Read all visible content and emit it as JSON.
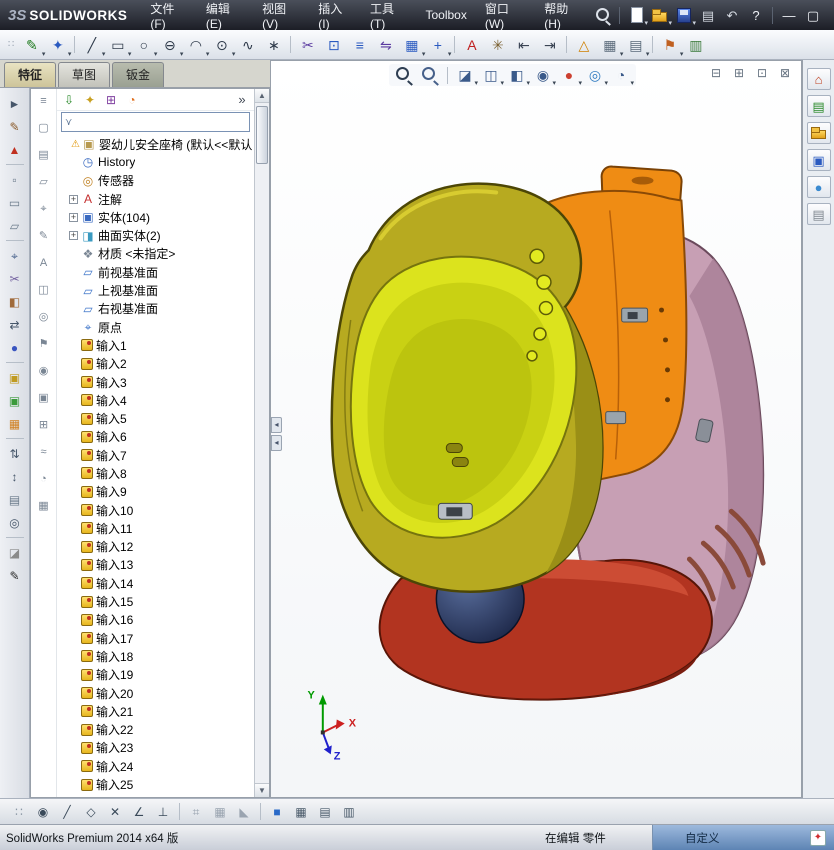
{
  "titlebar": {
    "logo_mark": "3S",
    "logo_text": "SOLIDWORKS",
    "menus": [
      "文件(F)",
      "编辑(E)",
      "视图(V)",
      "插入(I)",
      "工具(T)",
      "Toolbox",
      "窗口(W)",
      "帮助(H)"
    ],
    "icons": [
      {
        "name": "search-icon",
        "shape": "mag",
        "color": "#dde2ea"
      },
      {
        "sep": true
      },
      {
        "name": "new-file-icon",
        "shape": "page",
        "dd": true
      },
      {
        "name": "open-file-icon",
        "shape": "folder",
        "dd": true
      },
      {
        "name": "save-icon",
        "shape": "disk",
        "dd": true
      },
      {
        "name": "print-icon",
        "glyph": "▤",
        "color": "#d5dae2"
      },
      {
        "name": "undo-icon",
        "glyph": "↶",
        "color": "#d5dae2"
      },
      {
        "name": "help-icon",
        "glyph": "?",
        "color": "#eef1f6"
      },
      {
        "sep": true
      },
      {
        "name": "minimize-icon",
        "glyph": "—",
        "color": "#eef1f6"
      },
      {
        "name": "restore-icon",
        "glyph": "▢",
        "color": "#eef1f6"
      }
    ]
  },
  "main_toolbar": {
    "icons": [
      {
        "name": "sketch-icon",
        "glyph": "✎",
        "color": "#1e7a1e",
        "dd": true
      },
      {
        "name": "smart-dimension-icon",
        "glyph": "✦",
        "color": "#2a5ac0",
        "dd": true
      },
      {
        "sep": true
      },
      {
        "name": "line-icon",
        "glyph": "╱",
        "color": "#2e3a4a",
        "dd": true
      },
      {
        "name": "rectangle-icon",
        "glyph": "▭",
        "color": "#2e3a4a",
        "dd": true
      },
      {
        "name": "circle-icon",
        "glyph": "○",
        "color": "#2e3a4a",
        "dd": true
      },
      {
        "name": "slot-icon",
        "glyph": "⊖",
        "color": "#2e3a4a",
        "dd": true
      },
      {
        "name": "arc-icon",
        "glyph": "◠",
        "color": "#2e3a4a",
        "dd": true
      },
      {
        "name": "ellipse-icon",
        "glyph": "⊙",
        "color": "#2e3a4a",
        "dd": true
      },
      {
        "name": "spline-icon",
        "glyph": "∿",
        "color": "#2e3a4a"
      },
      {
        "name": "point-icon",
        "glyph": "∗",
        "color": "#2e3a4a"
      },
      {
        "sep": true
      },
      {
        "name": "trim-entities-icon",
        "glyph": "✂",
        "color": "#5a3aa0"
      },
      {
        "name": "convert-entities-icon",
        "glyph": "⊡",
        "color": "#2a5ac0"
      },
      {
        "name": "offset-entities-icon",
        "glyph": "≡",
        "color": "#2a5ac0"
      },
      {
        "name": "mirror-entities-icon",
        "glyph": "⇋",
        "color": "#5a3aa0"
      },
      {
        "name": "linear-pattern-icon",
        "glyph": "▦",
        "color": "#2a5ac0",
        "dd": true
      },
      {
        "name": "move-entities-icon",
        "glyph": "+",
        "color": "#2a5ac0",
        "dd": true
      },
      {
        "sep": true
      },
      {
        "name": "text-icon",
        "glyph": "A",
        "color": "#c02020"
      },
      {
        "name": "construction-geometry-icon",
        "glyph": "✳",
        "color": "#7a6030"
      },
      {
        "name": "dimension-left-icon",
        "glyph": "⇤",
        "color": "#3a4454"
      },
      {
        "name": "dimension-right-icon",
        "glyph": "⇥",
        "color": "#3a4454"
      },
      {
        "sep": true
      },
      {
        "name": "sketch-alert-icon",
        "glyph": "△",
        "color": "#d08000"
      },
      {
        "name": "grid-system-icon",
        "glyph": "▦",
        "color": "#5a6a7a",
        "dd": true
      },
      {
        "name": "instant3d-icon",
        "glyph": "▤",
        "color": "#5a6a7a",
        "dd": true
      },
      {
        "sep": true
      },
      {
        "name": "rapid-sketch-icon",
        "glyph": "⚑",
        "color": "#c06020",
        "dd": true
      },
      {
        "name": "chart-icon",
        "glyph": "▥",
        "color": "#3a7a3a"
      }
    ]
  },
  "tabs": [
    {
      "label": "特征",
      "name": "tab-features",
      "active": true
    },
    {
      "label": "草图",
      "name": "tab-sketch"
    },
    {
      "label": "钣金",
      "name": "tab-sheet-metal",
      "dark": true
    }
  ],
  "headsup": {
    "icons": [
      {
        "name": "zoom-fit-icon",
        "shape": "mag",
        "color": "#2e3e52"
      },
      {
        "name": "zoom-area-icon",
        "shape": "mag",
        "color": "#46608a"
      },
      {
        "sep": true
      },
      {
        "name": "section-view-icon",
        "glyph": "◪",
        "color": "#3a5a8a",
        "dd": true
      },
      {
        "name": "view-orientation-icon",
        "glyph": "◫",
        "color": "#3a5a8a",
        "dd": true
      },
      {
        "name": "display-style-icon",
        "glyph": "◧",
        "color": "#3a5a8a",
        "dd": true
      },
      {
        "name": "hide-show-items-icon",
        "glyph": "◉",
        "color": "#3a5a8a",
        "dd": true
      },
      {
        "name": "edit-appearance-icon",
        "glyph": "●",
        "color": "#cc4030",
        "dd": true
      },
      {
        "name": "apply-scene-icon",
        "glyph": "◎",
        "color": "#2e7ac0",
        "dd": true
      },
      {
        "name": "view-settings-icon",
        "glyph": "◔",
        "color": "#3a5a8a",
        "dd": true
      }
    ]
  },
  "pane_toggles": {
    "icons": [
      {
        "name": "split-horizontal-icon",
        "glyph": "⊟",
        "color": "#6a7684"
      },
      {
        "name": "split-vertical-icon",
        "glyph": "⊞",
        "color": "#6a7684"
      },
      {
        "name": "pane-restore-icon",
        "glyph": "⊡",
        "color": "#6a7684"
      },
      {
        "name": "pane-close-icon",
        "glyph": "⊠",
        "color": "#6a7684"
      }
    ]
  },
  "left_toolbar": {
    "icons": [
      {
        "name": "select-icon",
        "glyph": "►",
        "color": "#46566a"
      },
      {
        "name": "annotate-icon",
        "glyph": "✎",
        "color": "#8a5a2a"
      },
      {
        "name": "alert-icon",
        "glyph": "▲",
        "color": "#c03020"
      },
      {
        "sep": true
      },
      {
        "name": "filter-vertex-icon",
        "glyph": "▫",
        "color": "#6a7a8a"
      },
      {
        "name": "filter-edge-icon",
        "glyph": "▭",
        "color": "#6a7a8a"
      },
      {
        "name": "filter-face-icon",
        "glyph": "▱",
        "color": "#6a7a8a"
      },
      {
        "sep": true
      },
      {
        "name": "measure-icon",
        "glyph": "⌖",
        "color": "#46608a"
      },
      {
        "name": "section-tool-icon",
        "glyph": "✂",
        "color": "#7462a0"
      },
      {
        "name": "appearance-tool-icon",
        "glyph": "◧",
        "color": "#a06a3a"
      },
      {
        "name": "swap-icon",
        "glyph": "⇄",
        "color": "#46566a"
      },
      {
        "name": "render-sphere-icon",
        "glyph": "●",
        "color": "#3a55c0"
      },
      {
        "sep": true
      },
      {
        "name": "body-folder-icon",
        "glyph": "▣",
        "color": "#c09a20"
      },
      {
        "name": "surface-folder-icon",
        "glyph": "▣",
        "color": "#3a9a3a"
      },
      {
        "name": "pattern-tool-icon",
        "glyph": "▦",
        "color": "#d08020"
      },
      {
        "sep": true
      },
      {
        "name": "sort-icon",
        "glyph": "⇅",
        "color": "#46566a"
      },
      {
        "name": "reorder-icon",
        "glyph": "↕",
        "color": "#46566a"
      },
      {
        "name": "list-tool-icon",
        "glyph": "▤",
        "color": "#6a7a8a"
      },
      {
        "name": "target-tool-icon",
        "glyph": "◎",
        "color": "#46566a"
      },
      {
        "sep": true
      },
      {
        "name": "eraser-icon",
        "glyph": "◪",
        "color": "#8a8a8a"
      },
      {
        "name": "pen-icon",
        "glyph": "✎",
        "color": "#2a2a2a"
      }
    ]
  },
  "inner_toolbar": {
    "icons": [
      {
        "name": "menu-flyout-icon",
        "glyph": "≡",
        "color": "#7a8694"
      },
      {
        "name": "transparent-display-icon",
        "glyph": "▢",
        "color": "#7a8694"
      },
      {
        "name": "display-pane-icon",
        "glyph": "▤",
        "color": "#7a8694"
      },
      {
        "name": "planes-visibility-icon",
        "glyph": "▱",
        "color": "#7a8694"
      },
      {
        "name": "origins-visibility-icon",
        "glyph": "⌖",
        "color": "#7a8694"
      },
      {
        "name": "sketches-visibility-icon",
        "glyph": "✎",
        "color": "#7a8694"
      },
      {
        "name": "annotations-visibility-icon",
        "glyph": "A",
        "color": "#7a8694"
      },
      {
        "name": "split-display-icon",
        "glyph": "◫",
        "color": "#7a8694"
      },
      {
        "name": "appearance-filter-icon",
        "glyph": "◎",
        "color": "#7a8694"
      },
      {
        "name": "flag-filter-icon",
        "glyph": "⚑",
        "color": "#7a8694"
      },
      {
        "name": "eye-visibility-icon",
        "glyph": "◉",
        "color": "#7a8694"
      },
      {
        "name": "solid-display-icon",
        "glyph": "▣",
        "color": "#7a8694"
      },
      {
        "name": "expand-tree-icon",
        "glyph": "⊞",
        "color": "#7a8694"
      },
      {
        "name": "curvature-display-icon",
        "glyph": "≈",
        "color": "#7a8694"
      },
      {
        "name": "timeline-icon",
        "glyph": "◔",
        "color": "#7a8694"
      },
      {
        "name": "grid-visibility-icon",
        "glyph": "▦",
        "color": "#7a8694"
      }
    ]
  },
  "taskpane": {
    "icons": [
      {
        "name": "resources-home-icon",
        "glyph": "⌂",
        "color": "#c04020"
      },
      {
        "name": "design-library-icon",
        "glyph": "▤",
        "color": "#2a8a2a"
      },
      {
        "name": "file-explorer-icon",
        "shape": "folder"
      },
      {
        "name": "view-palette-icon",
        "glyph": "▣",
        "color": "#2a5ac0"
      },
      {
        "name": "appearances-icon",
        "glyph": "●",
        "color": "#3a8ad0"
      },
      {
        "name": "custom-properties-icon",
        "glyph": "▤",
        "color": "#808890"
      }
    ]
  },
  "featuremanager": {
    "tabs": [
      {
        "name": "featuremanager-tab-icon",
        "glyph": "⇩",
        "color": "#2a8a2a"
      },
      {
        "name": "propertymanager-tab-icon",
        "glyph": "✦",
        "color": "#c8a020"
      },
      {
        "name": "configurationmanager-tab-icon",
        "glyph": "⊞",
        "color": "#8040a0"
      },
      {
        "name": "displaymanager-tab-icon",
        "glyph": "◔",
        "color": "#e07020"
      },
      {
        "name": "expand-panel-icon",
        "glyph": "»",
        "color": "#404854",
        "cls": "end"
      }
    ],
    "filter": {
      "value": ""
    },
    "root": {
      "label": "婴幼儿安全座椅 (默认<<默认",
      "icon": "part-icon"
    },
    "items": [
      {
        "label": "History",
        "icon": "history-icon",
        "glyph": "◷",
        "color": "#3a6ac0"
      },
      {
        "label": "传感器",
        "icon": "sensors-icon",
        "glyph": "◎",
        "color": "#c08020"
      },
      {
        "label": "注解",
        "icon": "annotations-icon",
        "glyph": "A",
        "color": "#c43030",
        "expand": true
      },
      {
        "label": "实体(104)",
        "icon": "solid-bodies-icon",
        "glyph": "▣",
        "color": "#3a6ac0",
        "expand": true
      },
      {
        "label": "曲面实体(2)",
        "icon": "surface-bodies-icon",
        "glyph": "◨",
        "color": "#3a9ac0",
        "expand": true
      },
      {
        "label": "材质 <未指定>",
        "icon": "material-icon",
        "glyph": "❖",
        "color": "#7a8694"
      },
      {
        "label": "前视基准面",
        "icon": "front-plane-icon",
        "glyph": "▱",
        "color": "#3a72c8"
      },
      {
        "label": "上视基准面",
        "icon": "top-plane-icon",
        "glyph": "▱",
        "color": "#3a72c8"
      },
      {
        "label": "右视基准面",
        "icon": "right-plane-icon",
        "glyph": "▱",
        "color": "#3a72c8"
      },
      {
        "label": "原点",
        "icon": "origin-icon",
        "glyph": "⌖",
        "color": "#3a72c8"
      }
    ],
    "imports": [
      "输入1",
      "输入2",
      "输入3",
      "输入4",
      "输入5",
      "输入6",
      "输入7",
      "输入8",
      "输入9",
      "输入10",
      "输入11",
      "输入12",
      "输入13",
      "输入14",
      "输入15",
      "输入16",
      "输入17",
      "输入18",
      "输入19",
      "输入20",
      "输入21",
      "输入22",
      "输入23",
      "输入24",
      "输入25"
    ]
  },
  "sketch_toolbar": {
    "icons": [
      {
        "name": "grip-icon",
        "glyph": "∷",
        "color": "#8a96a4",
        "inter": false
      },
      {
        "name": "snap-center-icon",
        "glyph": "◉",
        "color": "#3a4a5a"
      },
      {
        "name": "snap-line-icon",
        "glyph": "╱",
        "color": "#3a4a5a"
      },
      {
        "name": "snap-polygon-icon",
        "glyph": "◇",
        "color": "#3a4a5a"
      },
      {
        "name": "snap-intersect-icon",
        "glyph": "✕",
        "color": "#3a4a5a"
      },
      {
        "name": "snap-tangent-icon",
        "glyph": "∠",
        "color": "#3a4a5a"
      },
      {
        "name": "snap-perpendicular-icon",
        "glyph": "⊥",
        "color": "#3a4a5a"
      },
      {
        "sep": true
      },
      {
        "name": "quick-snaps-icon",
        "glyph": "⌗",
        "color": "#9aa4b0"
      },
      {
        "name": "grid-snap-icon",
        "glyph": "▦",
        "color": "#9aa4b0"
      },
      {
        "name": "angle-snap-icon",
        "glyph": "◣",
        "color": "#9aa4b0"
      },
      {
        "sep": true
      },
      {
        "name": "shaded-sketch-icon",
        "glyph": "■",
        "color": "#2a6ac8"
      },
      {
        "name": "grid-settings-icon",
        "glyph": "▦",
        "color": "#4a5a6a"
      },
      {
        "name": "table-icon",
        "glyph": "▤",
        "color": "#4a5a6a"
      },
      {
        "name": "columns-icon",
        "glyph": "▥",
        "color": "#4a5a6a"
      }
    ]
  },
  "statusbar": {
    "left": "SolidWorks Premium 2014 x64 版",
    "editing": "在编辑 零件",
    "custom": "自定义"
  },
  "model": {
    "part_name": "婴幼儿安全座椅",
    "colors": {
      "shell_yellow": "#b7aa20",
      "seat_inner": "#dce31d",
      "seat_recess": "#c9d113",
      "insert_orange": "#ef8c14",
      "side_pink": "#c79fb4",
      "base_red": "#b23420",
      "knob_navy": "#20294e",
      "outline_dark": "#4c4606"
    },
    "triad": {
      "x": "X",
      "y": "Y",
      "z": "Z"
    }
  }
}
